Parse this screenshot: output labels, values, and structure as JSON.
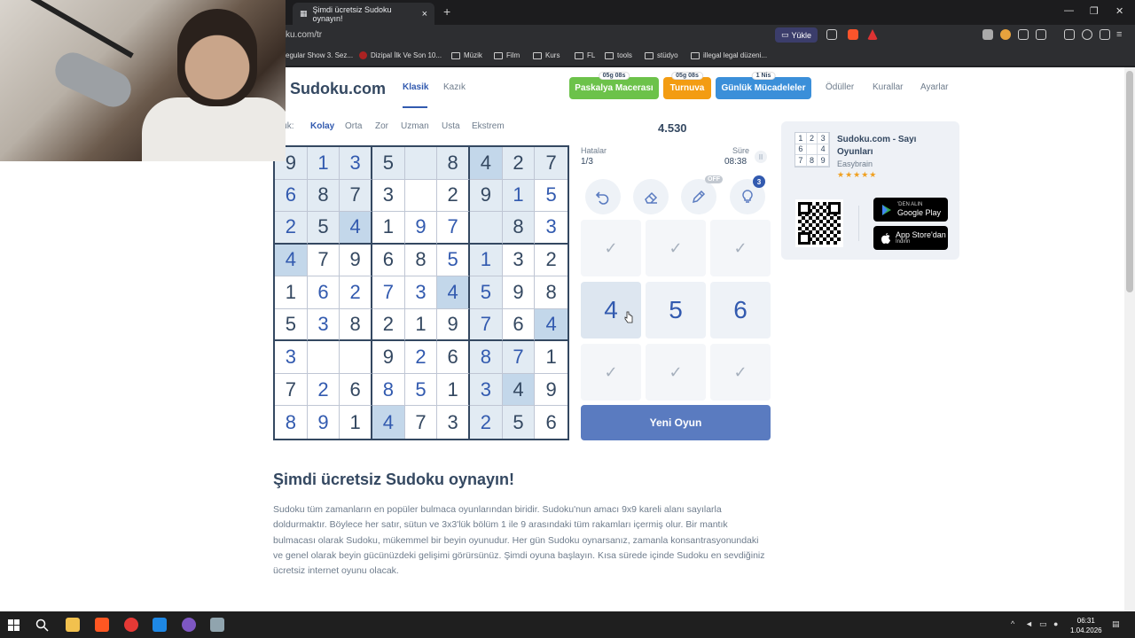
{
  "browser": {
    "tab_title": "Şimdi ücretsiz Sudoku oynayın!",
    "tab_close": "×",
    "new_tab": "+",
    "url": "ku.com/tr",
    "upload_label": "Yükle",
    "window_controls": [
      "—",
      "❐",
      "✕"
    ],
    "bookmarks": [
      {
        "label": "egular Show 3. Sez...",
        "icon": "page-icon"
      },
      {
        "label": "Dizipal İlk Ve Son 10...",
        "icon": "site-icon"
      },
      {
        "label": "Müzik",
        "icon": "folder-icon"
      },
      {
        "label": "Film",
        "icon": "folder-icon"
      },
      {
        "label": "Kurs",
        "icon": "folder-icon"
      },
      {
        "label": "FL",
        "icon": "folder-icon"
      },
      {
        "label": "tools",
        "icon": "folder-icon"
      },
      {
        "label": "stüdyo",
        "icon": "folder-icon"
      },
      {
        "label": "illegal legal düzeni...",
        "icon": "folder-icon"
      }
    ]
  },
  "nav": {
    "logo": "Sudoku.com",
    "links": [
      "Klasik",
      "Kazık"
    ],
    "active": "Klasik",
    "pills": [
      {
        "label": "Paskalya Macerası",
        "badge": "05g 08s",
        "color": "#6cc24a"
      },
      {
        "label": "Turnuva",
        "badge": "05g 08s",
        "color": "#f39c12"
      },
      {
        "label": "Günlük Mücadeleler",
        "badge": "1 Nis",
        "color": "#3b8fd9"
      }
    ],
    "right_links": [
      "Ödüller",
      "Kurallar",
      "Ayarlar"
    ]
  },
  "difficulty": {
    "prefix": "luk:",
    "levels": [
      "Kolay",
      "Orta",
      "Zor",
      "Uzman",
      "Usta",
      "Ekstrem"
    ],
    "selected": "Kolay"
  },
  "score": "4.530",
  "stats": {
    "mistakes_label": "Hatalar",
    "mistakes_value": "1/3",
    "time_label": "Süre",
    "time_value": "08:38",
    "pause_icon": "II"
  },
  "tools": {
    "off_badge": "OFF",
    "hint_count": "3",
    "icons": [
      "undo-icon",
      "eraser-icon",
      "pencil-icon",
      "lightbulb-icon"
    ]
  },
  "grid": {
    "values": [
      [
        "9",
        "1",
        "3",
        "5",
        "",
        "8",
        "4",
        "2",
        "7"
      ],
      [
        "6",
        "8",
        "7",
        "3",
        "",
        "2",
        "9",
        "1",
        "5"
      ],
      [
        "2",
        "5",
        "4",
        "1",
        "9",
        "7",
        "",
        "8",
        "3"
      ],
      [
        "4",
        "7",
        "9",
        "6",
        "8",
        "5",
        "1",
        "3",
        "2"
      ],
      [
        "1",
        "6",
        "2",
        "7",
        "3",
        "4",
        "5",
        "9",
        "8"
      ],
      [
        "5",
        "3",
        "8",
        "2",
        "1",
        "9",
        "7",
        "6",
        "4"
      ],
      [
        "3",
        "",
        "",
        "9",
        "2",
        "6",
        "8",
        "7",
        "1"
      ],
      [
        "7",
        "2",
        "6",
        "8",
        "5",
        "1",
        "3",
        "4",
        "9"
      ],
      [
        "8",
        "9",
        "1",
        "4",
        "7",
        "3",
        "2",
        "5",
        "6"
      ]
    ],
    "user_entries": [
      [
        0,
        1
      ],
      [
        0,
        2
      ],
      [
        1,
        0
      ],
      [
        1,
        7
      ],
      [
        1,
        8
      ],
      [
        2,
        0
      ],
      [
        2,
        2
      ],
      [
        2,
        4
      ],
      [
        2,
        5
      ],
      [
        2,
        8
      ],
      [
        3,
        0
      ],
      [
        3,
        5
      ],
      [
        3,
        6
      ],
      [
        4,
        1
      ],
      [
        4,
        2
      ],
      [
        4,
        3
      ],
      [
        4,
        4
      ],
      [
        4,
        5
      ],
      [
        4,
        6
      ],
      [
        5,
        1
      ],
      [
        5,
        6
      ],
      [
        5,
        8
      ],
      [
        6,
        0
      ],
      [
        6,
        4
      ],
      [
        6,
        6
      ],
      [
        6,
        7
      ],
      [
        7,
        1
      ],
      [
        7,
        3
      ],
      [
        7,
        4
      ],
      [
        7,
        6
      ],
      [
        8,
        0
      ],
      [
        8,
        1
      ],
      [
        8,
        3
      ],
      [
        8,
        6
      ]
    ],
    "highlighted_cells": [
      [
        0,
        0
      ],
      [
        0,
        1
      ],
      [
        0,
        2
      ],
      [
        0,
        4
      ],
      [
        0,
        6
      ],
      [
        0,
        7
      ],
      [
        1,
        0
      ],
      [
        1,
        1
      ],
      [
        1,
        2
      ],
      [
        1,
        6
      ],
      [
        1,
        7
      ],
      [
        2,
        0
      ],
      [
        2,
        1
      ],
      [
        2,
        6
      ],
      [
        2,
        7
      ],
      [
        0,
        3
      ],
      [
        0,
        5
      ],
      [
        0,
        8
      ],
      [
        3,
        6
      ],
      [
        4,
        6
      ],
      [
        5,
        6
      ],
      [
        6,
        6
      ],
      [
        7,
        6
      ],
      [
        8,
        6
      ],
      [
        6,
        7
      ],
      [
        7,
        7
      ],
      [
        8,
        7
      ]
    ],
    "same_number_cells": [
      [
        0,
        6
      ],
      [
        2,
        2
      ],
      [
        3,
        0
      ],
      [
        4,
        5
      ],
      [
        5,
        8
      ],
      [
        8,
        3
      ],
      [
        7,
        7
      ]
    ]
  },
  "numpad": {
    "cells": [
      {
        "label": "✓",
        "state": "done"
      },
      {
        "label": "✓",
        "state": "done"
      },
      {
        "label": "✓",
        "state": "done"
      },
      {
        "label": "4",
        "state": "active"
      },
      {
        "label": "5",
        "state": "normal"
      },
      {
        "label": "6",
        "state": "normal"
      },
      {
        "label": "✓",
        "state": "done"
      },
      {
        "label": "✓",
        "state": "done"
      },
      {
        "label": "✓",
        "state": "done"
      }
    ]
  },
  "new_game": "Yeni Oyun",
  "app_card": {
    "icon_digits": [
      "1",
      "2",
      "3",
      "6",
      "",
      "4",
      "7",
      "8",
      "9"
    ],
    "title": "Sudoku.com - Sayı Oyunları",
    "developer": "Easybrain",
    "stars": "★★★★★",
    "rating": 4.5,
    "google_small": "'DEN ALIN",
    "google_big": "Google Play",
    "apple_small": "İndirin",
    "apple_big": "App Store'dan"
  },
  "content": {
    "heading": "Şimdi ücretsiz Sudoku oynayın!",
    "paragraph": "Sudoku tüm zamanların en popüler bulmaca oyunlarından biridir. Sudoku'nun amacı 9x9 kareli alanı sayılarla doldurmaktır. Böylece her satır, sütun ve 3x3'lük bölüm 1 ile 9 arasındaki tüm rakamları içermiş olur. Bir mantık bulmacası olarak Sudoku, mükemmel bir beyin oyunudur. Her gün Sudoku oynarsanız, zamanla konsantrasyonundaki ve genel olarak beyin gücünüzdeki gelişimi görürsünüz. Şimdi oyuna başlayın. Kısa sürede içinde Sudoku en sevdiğiniz ücretsiz internet oyunu olacak."
  },
  "taskbar": {
    "time": "06:31",
    "date": "1.04.2026",
    "colors": [
      "#ff5722",
      "#e53935",
      "#1e88e5",
      "#7e57c2",
      "#90a4ae"
    ]
  }
}
